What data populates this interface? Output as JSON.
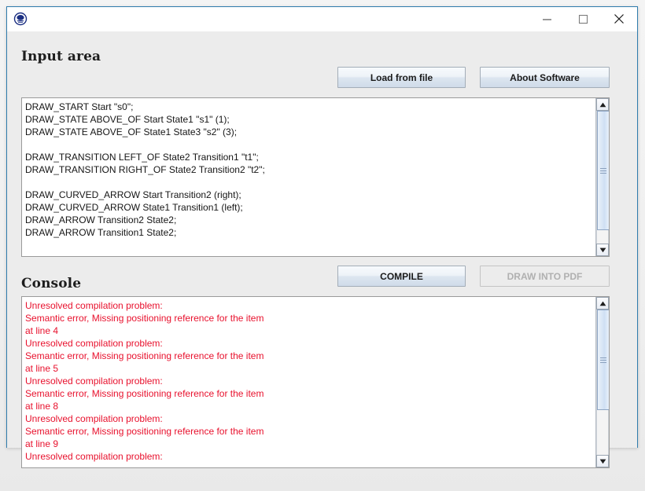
{
  "window": {
    "icon_name": "java-duke-icon",
    "title": "",
    "controls": {
      "minimize_label": "minimize-icon",
      "maximize_label": "maximize-icon",
      "close_label": "close-icon"
    }
  },
  "input_section": {
    "heading": "Input area",
    "load_button": "Load from file",
    "about_button": "About Software",
    "code_lines": [
      "DRAW_START Start \"s0\";",
      "DRAW_STATE ABOVE_OF Start State1 \"s1\" (1);",
      "DRAW_STATE ABOVE_OF State1 State3 \"s2\" (3);",
      "",
      "DRAW_TRANSITION LEFT_OF State2 Transition1 \"t1\";",
      "DRAW_TRANSITION RIGHT_OF State2 Transition2 \"t2\";",
      "",
      "DRAW_CURVED_ARROW Start Transition2 (right);",
      "DRAW_CURVED_ARROW State1 Transition1 (left);",
      "DRAW_ARROW Transition2 State2;",
      "DRAW_ARROW Transition1 State2;"
    ]
  },
  "console_section": {
    "heading": "Console",
    "compile_button": "COMPILE",
    "draw_button": "DRAW INTO PDF",
    "draw_button_enabled": false,
    "error_color": "#e8112d",
    "output_lines": [
      "Unresolved compilation problem:",
      "Semantic error, Missing positioning reference for the item",
      "at line 4",
      "Unresolved compilation problem:",
      "Semantic error, Missing positioning reference for the item",
      "at line 5",
      "Unresolved compilation problem:",
      "Semantic error, Missing positioning reference for the item",
      "at line 8",
      "Unresolved compilation problem:",
      "Semantic error, Missing positioning reference for the item",
      "at line 9",
      "Unresolved compilation problem:"
    ]
  },
  "theme": {
    "window_border": "#2f7cad",
    "client_background": "#ececec",
    "pane_background": "#ffffff"
  }
}
